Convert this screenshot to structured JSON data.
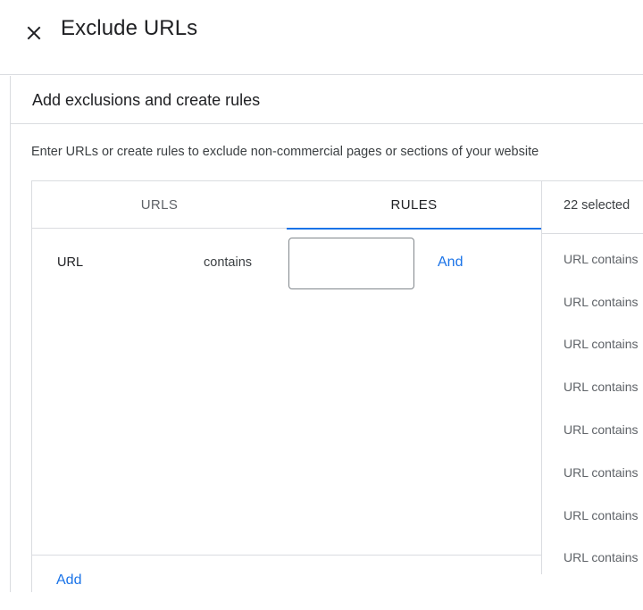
{
  "header": {
    "title": "Exclude URLs",
    "close_icon": "close-icon"
  },
  "section": {
    "title": "Add exclusions and create rules",
    "description": "Enter URLs or create rules to exclude non-commercial pages or sections of your website"
  },
  "tabs": [
    {
      "label": "URLS",
      "active": false
    },
    {
      "label": "RULES",
      "active": true
    }
  ],
  "rule": {
    "field": "URL",
    "operator": "contains",
    "value": "",
    "placeholder": "",
    "and_label": "And"
  },
  "add_label": "Add",
  "selected": {
    "count_label": "22 selected",
    "items": [
      "URL contains",
      "URL contains",
      "URL contains",
      "URL contains",
      "URL contains",
      "URL contains",
      "URL contains",
      "URL contains"
    ]
  },
  "colors": {
    "accent": "#1a73e8",
    "divider": "#dadce0",
    "text_primary": "#202124",
    "text_secondary": "#5f6368"
  }
}
